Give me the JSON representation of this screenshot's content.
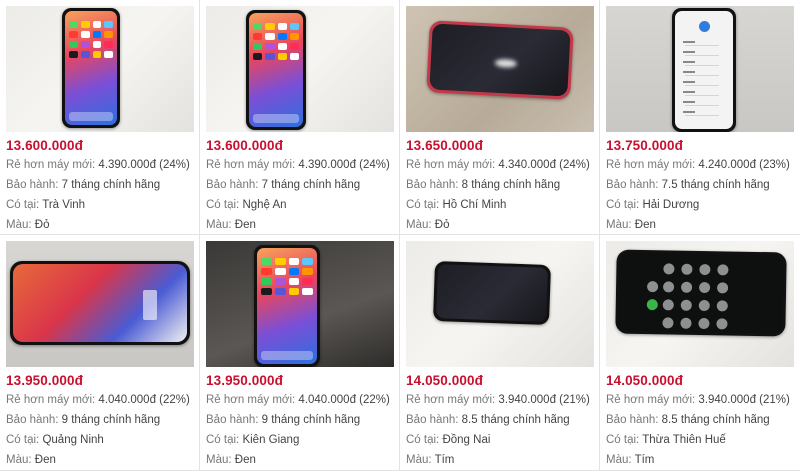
{
  "labels": {
    "cheaper_prefix": "Rẻ hơn máy mới:",
    "warranty_prefix": "Bảo hành:",
    "location_prefix": "Có tại:",
    "color_prefix": "Màu:"
  },
  "colors": {
    "price": "#c8102e"
  },
  "products": [
    {
      "price": "13.600.000đ",
      "cheaper": "4.390.000đ (24%)",
      "warranty": "7 tháng chính hãng",
      "location": "Trà Vinh",
      "color": "Đỏ",
      "image": "iphone-home-screen"
    },
    {
      "price": "13.600.000đ",
      "cheaper": "4.390.000đ (24%)",
      "warranty": "7 tháng chính hãng",
      "location": "Nghệ An",
      "color": "Đen",
      "image": "iphone-home-screen"
    },
    {
      "price": "13.650.000đ",
      "cheaper": "4.340.000đ (24%)",
      "warranty": "8 tháng chính hãng",
      "location": "Hồ Chí Minh",
      "color": "Đỏ",
      "image": "iphone-black-screen"
    },
    {
      "price": "13.750.000đ",
      "cheaper": "4.240.000đ (23%)",
      "warranty": "7.5 tháng chính hãng",
      "location": "Hải Dương",
      "color": "Đen",
      "image": "iphone-language-screen"
    },
    {
      "price": "13.950.000đ",
      "cheaper": "4.040.000đ (22%)",
      "warranty": "9 tháng chính hãng",
      "location": "Quảng Ninh",
      "color": "Đen",
      "image": "iphone-landscape-lockscreen"
    },
    {
      "price": "13.950.000đ",
      "cheaper": "4.040.000đ (22%)",
      "warranty": "9 tháng chính hãng",
      "location": "Kiên Giang",
      "color": "Đen",
      "image": "iphone-home-screen"
    },
    {
      "price": "14.050.000đ",
      "cheaper": "3.940.000đ (21%)",
      "warranty": "8.5 tháng chính hãng",
      "location": "Đồng Nai",
      "color": "Tím",
      "image": "iphone-black-screen"
    },
    {
      "price": "14.050.000đ",
      "cheaper": "3.940.000đ (21%)",
      "warranty": "8.5 tháng chính hãng",
      "location": "Thừa Thiên Huế",
      "color": "Tím",
      "image": "iphone-calculator-screen"
    }
  ]
}
